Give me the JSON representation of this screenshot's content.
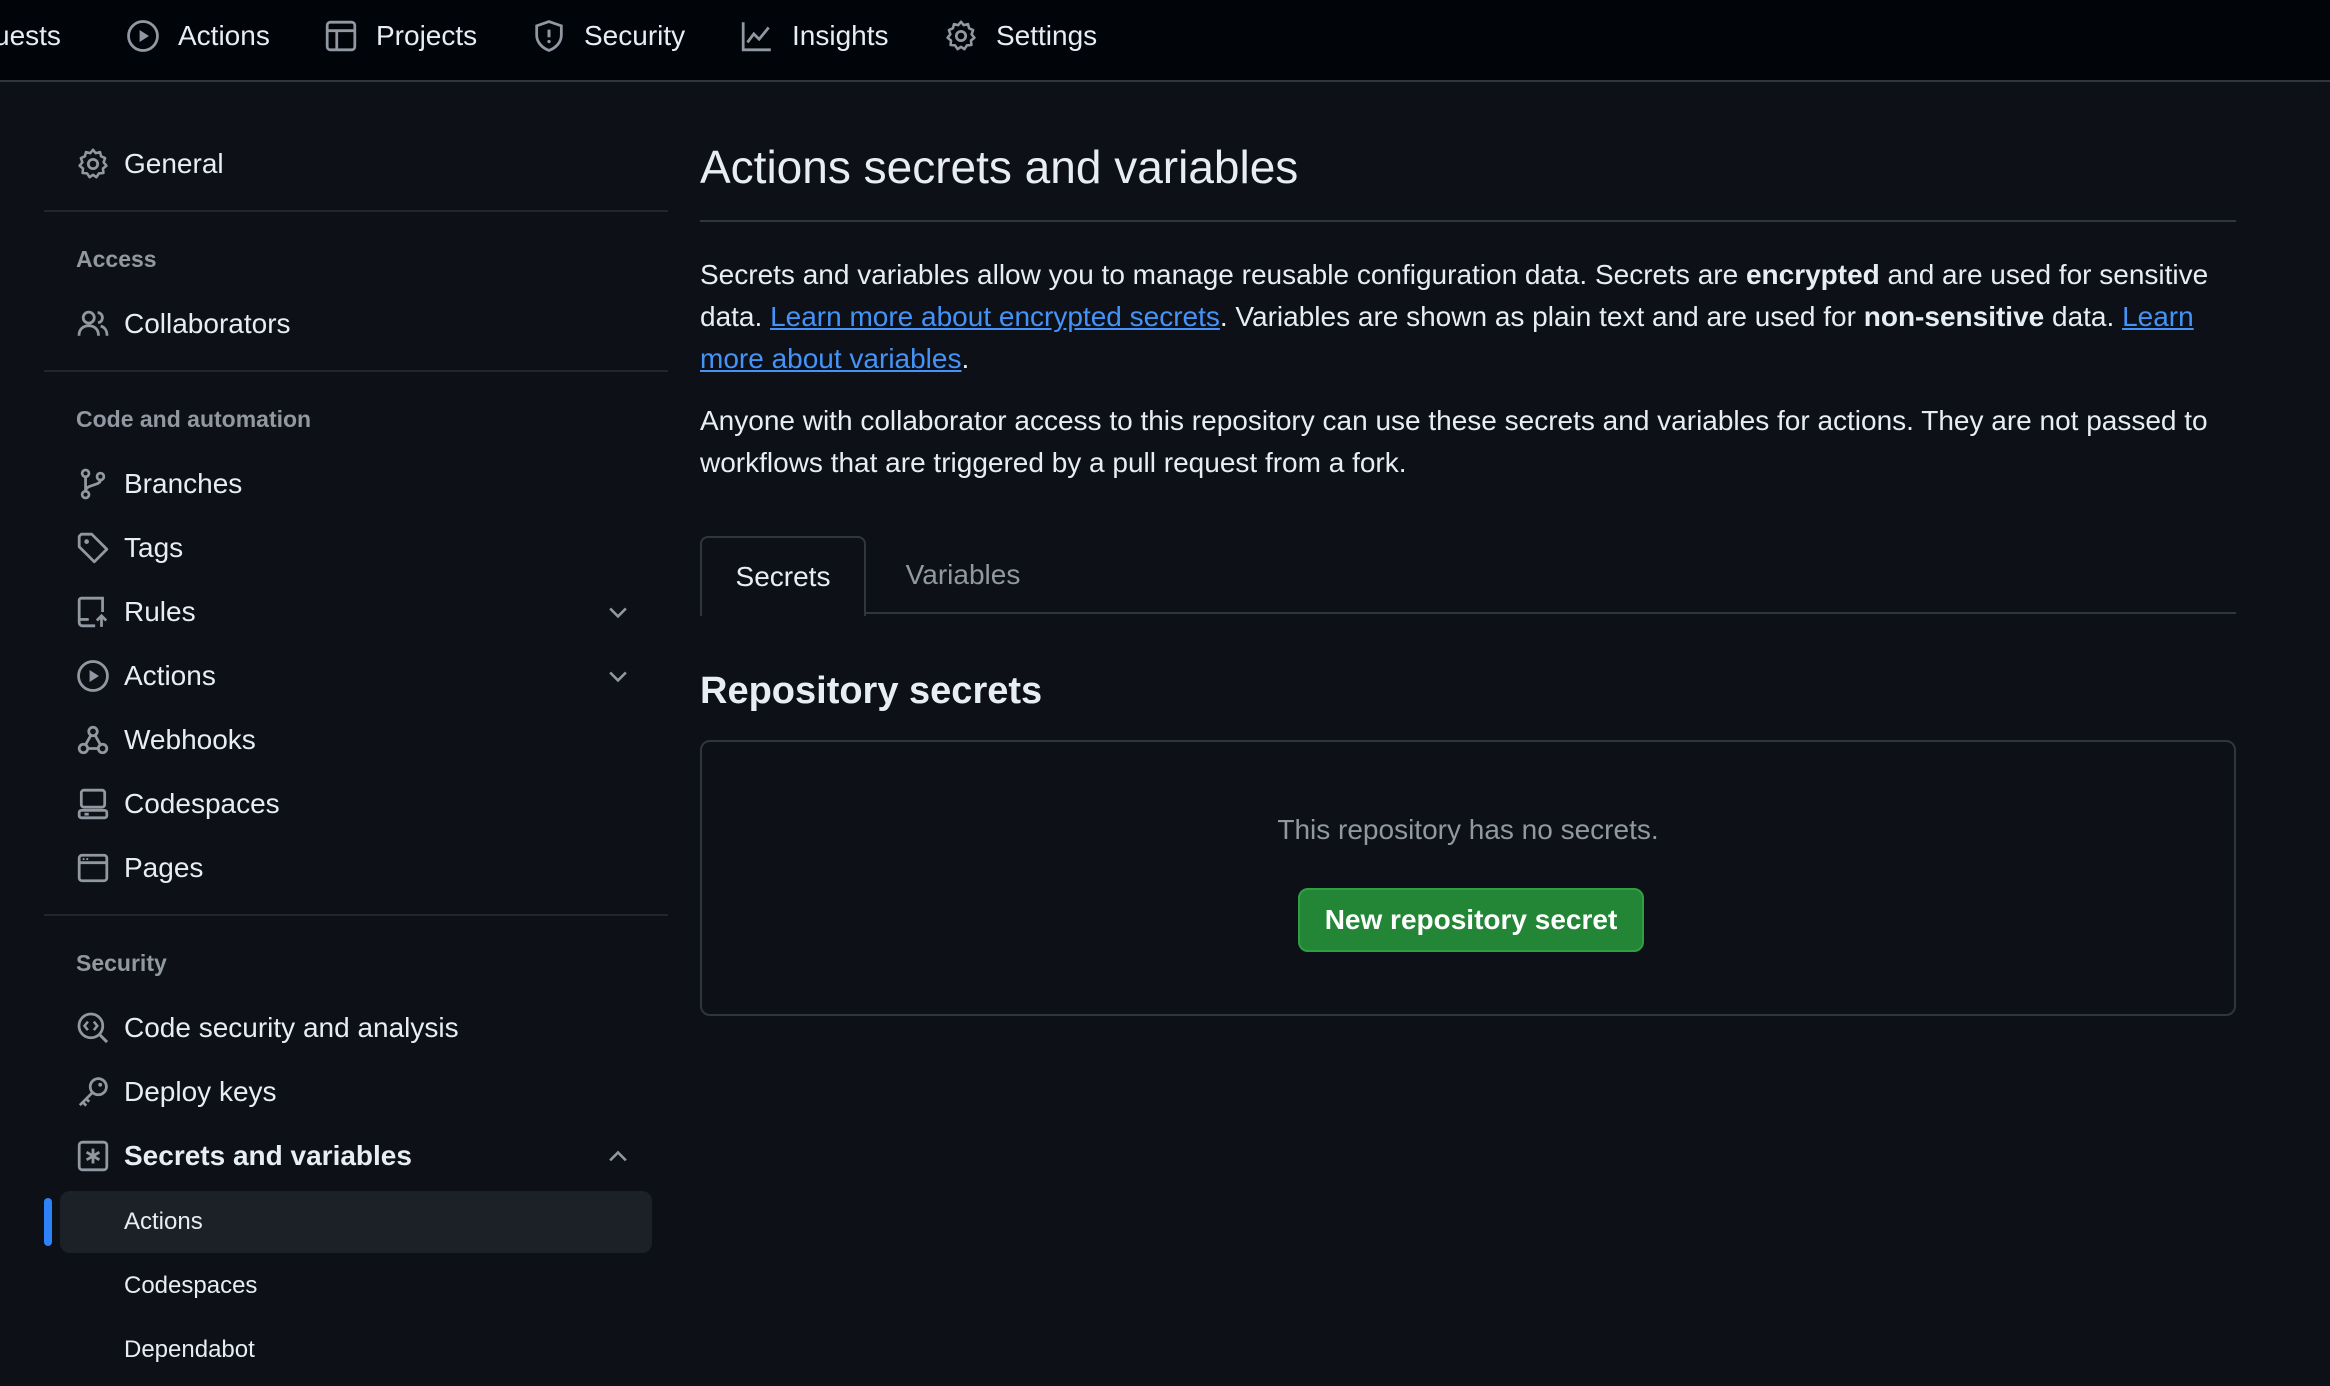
{
  "topnav": {
    "items": [
      {
        "label": "uests",
        "icon": "pull-request-icon"
      },
      {
        "label": "Actions",
        "icon": "play-icon"
      },
      {
        "label": "Projects",
        "icon": "table-icon"
      },
      {
        "label": "Security",
        "icon": "shield-icon"
      },
      {
        "label": "Insights",
        "icon": "graph-icon"
      },
      {
        "label": "Settings",
        "icon": "gear-icon"
      }
    ]
  },
  "sidebar": {
    "general": "General",
    "access_heading": "Access",
    "collaborators": "Collaborators",
    "code_heading": "Code and automation",
    "branches": "Branches",
    "tags": "Tags",
    "rules": "Rules",
    "actions": "Actions",
    "webhooks": "Webhooks",
    "codespaces": "Codespaces",
    "pages": "Pages",
    "security_heading": "Security",
    "code_security": "Code security and analysis",
    "deploy_keys": "Deploy keys",
    "secrets_variables": "Secrets and variables",
    "sub_actions": "Actions",
    "sub_codespaces": "Codespaces",
    "sub_dependabot": "Dependabot"
  },
  "main": {
    "title": "Actions secrets and variables",
    "intro": {
      "t1": "Secrets and variables allow you to manage reusable configuration data. Secrets are ",
      "b1": "encrypted",
      "t2": " and are used for sensitive data. ",
      "link1": "Learn more about encrypted secrets",
      "t3": ". Variables are shown as plain text and are used for ",
      "b2": "non-sensitive",
      "t4": " data. ",
      "link2": "Learn more about variables",
      "t5": "."
    },
    "access_note": "Anyone with collaborator access to this repository can use these secrets and variables for actions. They are not passed to workflows that are triggered by a pull request from a fork.",
    "tabs": {
      "secrets": "Secrets",
      "variables": "Variables"
    },
    "section_title": "Repository secrets",
    "empty_text": "This repository has no secrets.",
    "new_button": "New repository secret"
  },
  "colors": {
    "background": "#0d1117",
    "accent_blue": "#2f81f7",
    "button_green": "#238636",
    "link": "#4493f8"
  }
}
